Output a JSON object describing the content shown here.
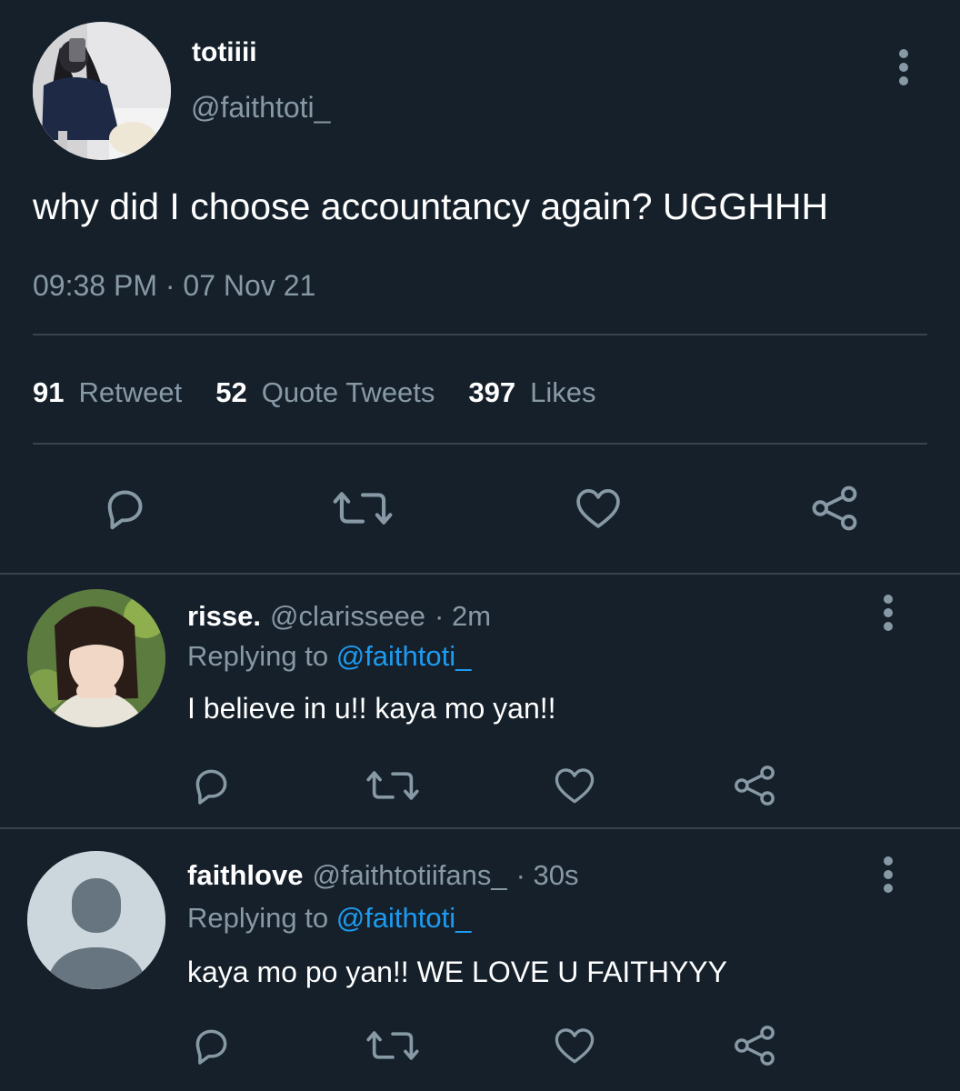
{
  "tweet": {
    "author": {
      "display_name": "totiiii",
      "handle": "@faithtoti_",
      "avatar_icon": "profile-photo"
    },
    "text": "why did I choose accountancy again? UGGHHH",
    "timestamp": "09:38 PM · 07 Nov 21",
    "stats": [
      {
        "count": "91",
        "label": "Retweet"
      },
      {
        "count": "52",
        "label": "Quote Tweets"
      },
      {
        "count": "397",
        "label": "Likes"
      }
    ],
    "actions": [
      "reply-icon",
      "retweet-icon",
      "like-icon",
      "share-icon"
    ]
  },
  "replies": [
    {
      "display_name": "risse.",
      "handle": "@clarisseee",
      "time": "· 2m",
      "replying_prefix": "Replying to",
      "replying_to": "@faithtoti_",
      "text": "I believe in u!! kaya mo yan!!"
    },
    {
      "display_name": "faithlove",
      "handle": "@faithtotiifans_",
      "time": "· 30s",
      "replying_prefix": "Replying to",
      "replying_to": "@faithtoti_",
      "text": "kaya mo po yan!! WE LOVE U FAITHYYY"
    }
  ],
  "colors": {
    "background": "#15202b",
    "text": "#ffffff",
    "muted": "#8899a6",
    "link": "#1d9bf0",
    "divider": "#38444d"
  }
}
